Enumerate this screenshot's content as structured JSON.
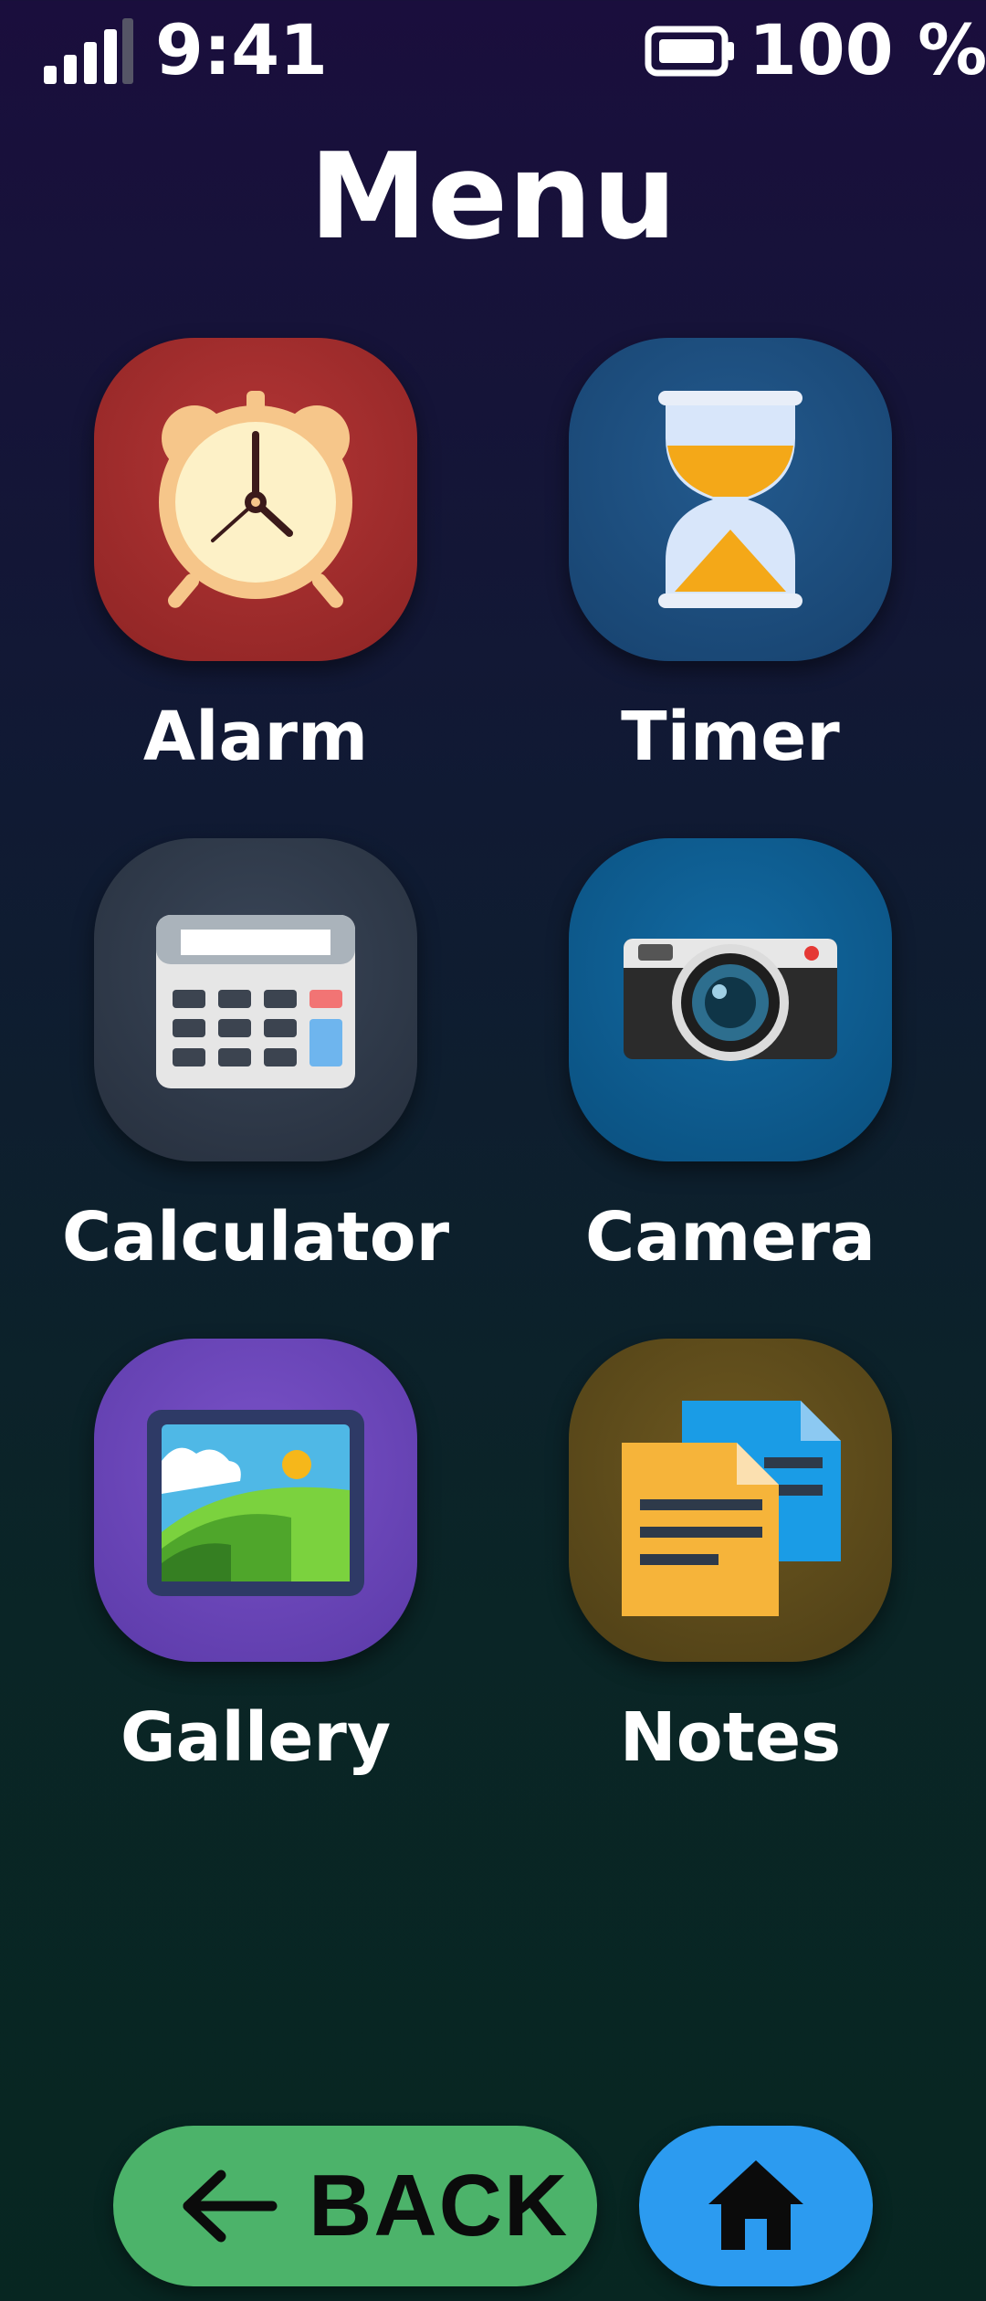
{
  "status_bar": {
    "time": "9:41",
    "battery_text": "100 %",
    "signal_icon": "signal-bars-icon",
    "battery_icon": "battery-full-icon"
  },
  "page": {
    "title": "Menu"
  },
  "apps": [
    {
      "label": "Alarm",
      "icon": "alarm-clock-icon",
      "color": "#9c2a2a"
    },
    {
      "label": "Timer",
      "icon": "hourglass-icon",
      "color": "#1b4d7e"
    },
    {
      "label": "Calculator",
      "icon": "calculator-icon",
      "color": "#2e3848"
    },
    {
      "label": "Camera",
      "icon": "camera-icon",
      "color": "#0d5b8e"
    },
    {
      "label": "Gallery",
      "icon": "picture-icon",
      "color": "#6a44b8"
    },
    {
      "label": "Notes",
      "icon": "notes-icon",
      "color": "#5c4a1c"
    }
  ],
  "nav": {
    "back_label": "BACK",
    "back_icon": "arrow-left-icon",
    "back_color": "#4cb36a",
    "home_icon": "home-icon",
    "home_color": "#2c9bf0"
  }
}
